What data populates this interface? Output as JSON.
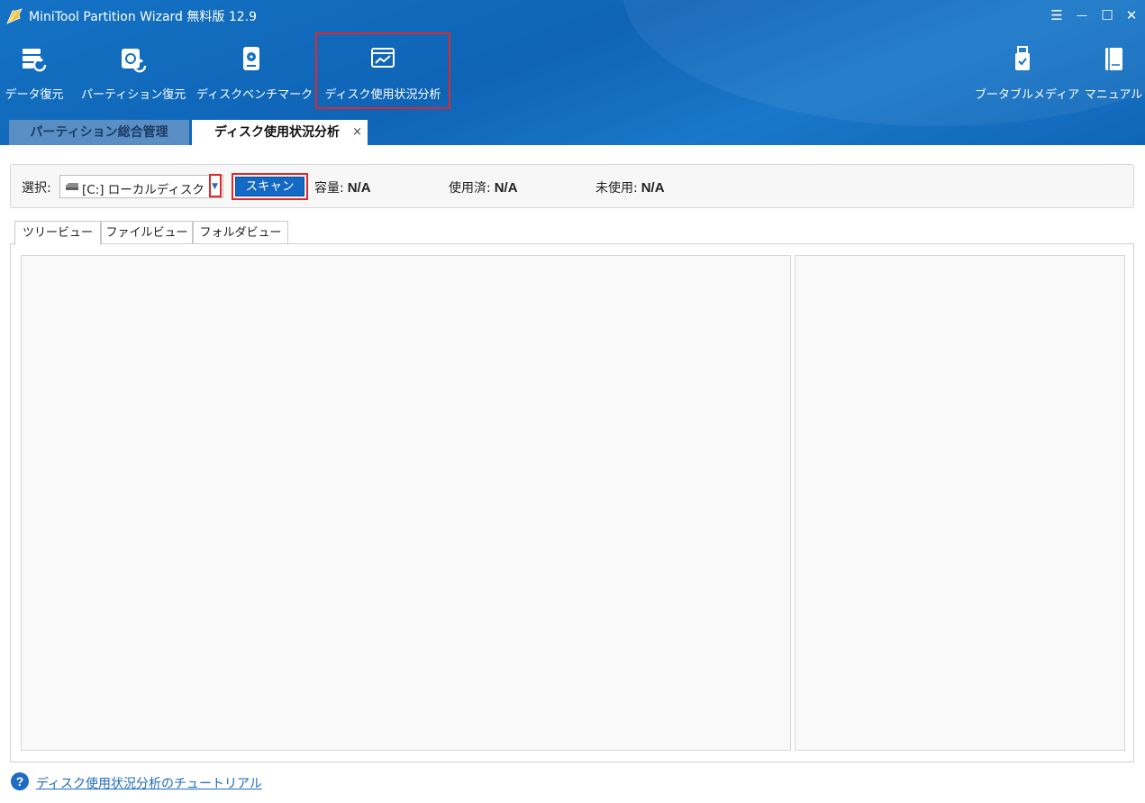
{
  "app": {
    "title": "MiniTool Partition Wizard 無料版 12.9"
  },
  "window_controls": {
    "menu": "☰",
    "minimize": "—",
    "maximize": "☐",
    "close": "✕"
  },
  "toolbar": {
    "data_recovery": "データ復元",
    "partition_recovery": "パーティション復元",
    "disk_benchmark": "ディスクベンチマーク",
    "space_analyzer": "ディスク使用状況分析",
    "bootable_media": "ブータブルメディア",
    "manual": "マニュアル"
  },
  "main_tabs": {
    "partition_management": "パーティション総合管理",
    "space_analyzer": "ディスク使用状況分析",
    "close": "×"
  },
  "select_bar": {
    "select_label": "選択:",
    "drive_value": "[C:] ローカルディスク",
    "scan_button": "スキャン",
    "capacity_label": "容量:",
    "capacity_value": "N/A",
    "used_label": "使用済:",
    "used_value": "N/A",
    "free_label": "未使用:",
    "free_value": "N/A"
  },
  "view_tabs": {
    "tree_view": "ツリービュー",
    "file_view": "ファイルビュー",
    "folder_view": "フォルダビュー"
  },
  "footer": {
    "tutorial_link": "ディスク使用状況分析のチュートリアル"
  }
}
